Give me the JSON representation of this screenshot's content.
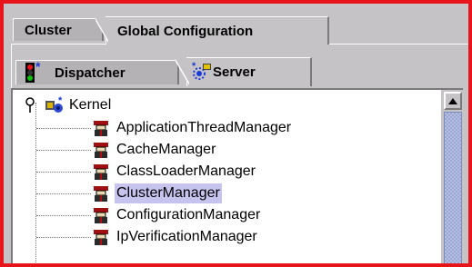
{
  "outer_tabs": [
    {
      "label": "Cluster",
      "active": false
    },
    {
      "label": "Global Configuration",
      "active": true
    }
  ],
  "inner_tabs": [
    {
      "label": "Dispatcher",
      "icon": "traffic-light-icon",
      "active": false
    },
    {
      "label": "Server",
      "icon": "server-gear-icon",
      "active": true
    }
  ],
  "tree": {
    "root": {
      "label": "Kernel",
      "icon": "kernel-icon",
      "expanded": true
    },
    "children": [
      {
        "label": "ApplicationThreadManager",
        "selected": false
      },
      {
        "label": "CacheManager",
        "selected": false
      },
      {
        "label": "ClassLoaderManager",
        "selected": false
      },
      {
        "label": "ClusterManager",
        "selected": true
      },
      {
        "label": "ConfigurationManager",
        "selected": false
      },
      {
        "label": "IpVerificationManager",
        "selected": false
      }
    ]
  },
  "colors": {
    "frame_border": "#e8141b",
    "panel_bg": "#c6c3c6",
    "selection_bg": "#c6c3ef",
    "scroll_thumb": "#b6bfe0"
  }
}
